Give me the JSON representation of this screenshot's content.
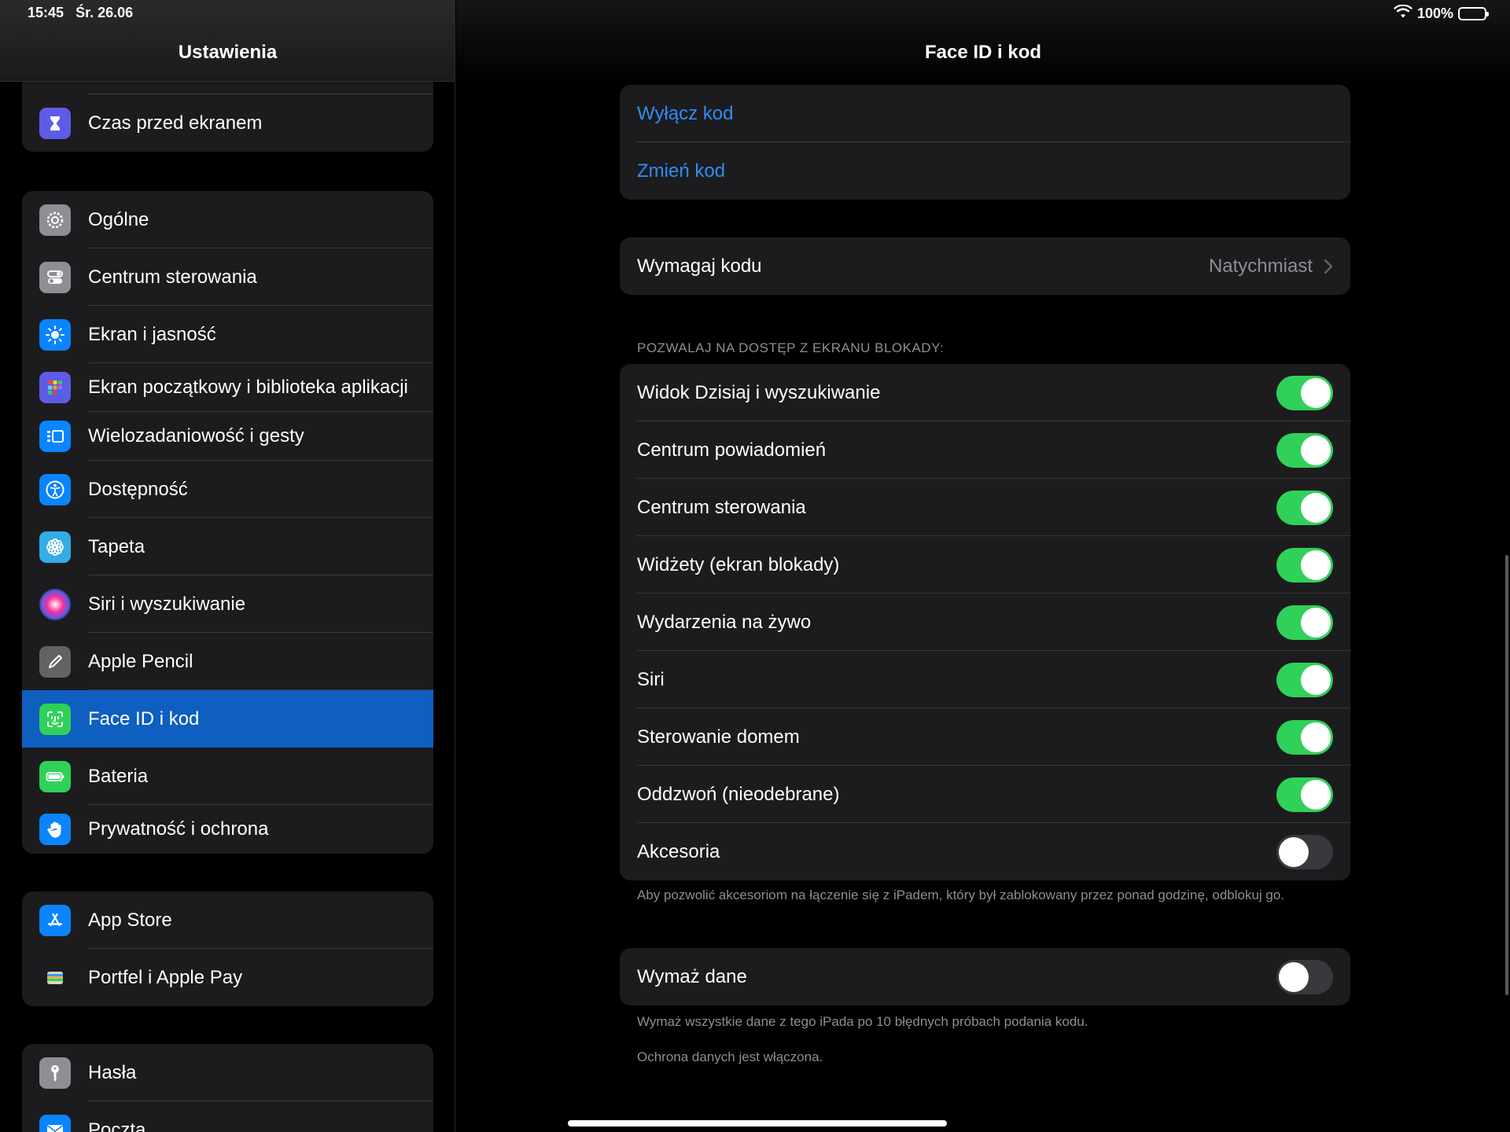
{
  "status_bar": {
    "time": "15:45",
    "date": "Śr. 26.06",
    "battery": "100%"
  },
  "sidebar": {
    "title": "Ustawienia",
    "groups": [
      {
        "items": [
          {
            "label": "Czas przed ekranem",
            "icon": "hourglass-icon"
          }
        ]
      },
      {
        "items": [
          {
            "label": "Ogólne",
            "icon": "gear-icon"
          },
          {
            "label": "Centrum sterowania",
            "icon": "switches-icon"
          },
          {
            "label": "Ekran i jasność",
            "icon": "sun-icon"
          },
          {
            "label": "Ekran początkowy i biblioteka aplikacji",
            "icon": "app-grid-icon"
          },
          {
            "label": "Wielozadaniowość i gesty",
            "icon": "multitasking-icon"
          },
          {
            "label": "Dostępność",
            "icon": "accessibility-icon"
          },
          {
            "label": "Tapeta",
            "icon": "flower-icon"
          },
          {
            "label": "Siri i wyszukiwanie",
            "icon": "siri-icon"
          },
          {
            "label": "Apple Pencil",
            "icon": "pencil-icon"
          },
          {
            "label": "Face ID i kod",
            "icon": "face-id-icon",
            "selected": true
          },
          {
            "label": "Bateria",
            "icon": "battery-icon"
          },
          {
            "label": "Prywatność i ochrona",
            "icon": "hand-icon"
          }
        ]
      },
      {
        "items": [
          {
            "label": "App Store",
            "icon": "app-store-icon"
          },
          {
            "label": "Portfel i Apple Pay",
            "icon": "wallet-icon"
          }
        ]
      },
      {
        "items": [
          {
            "label": "Hasła",
            "icon": "key-icon"
          },
          {
            "label": "Poczta",
            "icon": "mail-icon"
          }
        ]
      }
    ]
  },
  "main": {
    "title": "Face ID i kod",
    "passcode_actions": [
      "Wyłącz kod",
      "Zmień kod"
    ],
    "require_passcode": {
      "label": "Wymagaj kodu",
      "value": "Natychmiast"
    },
    "lock_screen_access": {
      "header": "POZWALAJ NA DOSTĘP Z EKRANU BLOKADY:",
      "items": [
        {
          "label": "Widok Dzisiaj i wyszukiwanie",
          "on": true
        },
        {
          "label": "Centrum powiadomień",
          "on": true
        },
        {
          "label": "Centrum sterowania",
          "on": true
        },
        {
          "label": "Widżety (ekran blokady)",
          "on": true
        },
        {
          "label": "Wydarzenia na żywo",
          "on": true
        },
        {
          "label": "Siri",
          "on": true
        },
        {
          "label": "Sterowanie domem",
          "on": true
        },
        {
          "label": "Oddzwoń (nieodebrane)",
          "on": true
        },
        {
          "label": "Akcesoria",
          "on": false
        }
      ],
      "footer": "Aby pozwolić akcesoriom na łączenie się z iPadem, który był zablokowany przez ponad godzinę, odblokuj go."
    },
    "erase_data": {
      "label": "Wymaż dane",
      "on": false,
      "footer": "Wymaż wszystkie dane z tego iPada po 10 błędnych próbach podania kodu.",
      "footer2": "Ochrona danych jest włączona."
    }
  },
  "colors": {
    "accent": "#2f8cf5",
    "toggle_on": "#30d158",
    "selected": "#0f5fc0"
  }
}
